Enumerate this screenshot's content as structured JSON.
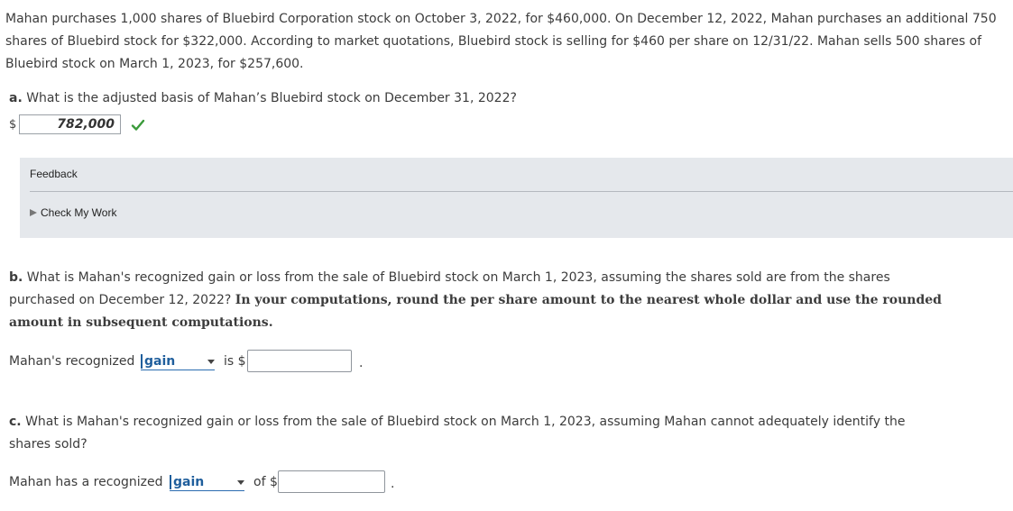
{
  "intro": "Mahan purchases 1,000 shares of Bluebird Corporation stock on October 3, 2022, for $460,000. On December 12, 2022, Mahan purchases an additional 750 shares of Bluebird stock for $322,000. According to market quotations, Bluebird stock is selling for $460 per share on 12/31/22. Mahan sells 500 shares of Bluebird stock on March 1, 2023, for $257,600.",
  "part_a": {
    "label": "a.",
    "question": "What is the adjusted basis of Mahan’s Bluebird stock on December 31, 2022?",
    "currency": "$",
    "answer": "782,000"
  },
  "feedback": {
    "title": "Feedback",
    "check_my_work": "Check My Work"
  },
  "part_b": {
    "label": "b.",
    "question": "What is Mahan's recognized gain or loss from the sale of Bluebird stock on March 1, 2023, assuming the shares sold are from the shares purchased on December 12, 2022?",
    "instruction": "In your computations, round the per share amount to the nearest whole dollar and use the rounded amount in subsequent computations.",
    "prefix": "Mahan's recognized",
    "selected": "gain",
    "mid": "is $",
    "suffix": "."
  },
  "part_c": {
    "label": "c.",
    "question": "What is Mahan's recognized gain or loss from the sale of Bluebird stock on March 1, 2023, assuming Mahan cannot adequately identify the shares sold?",
    "prefix": "Mahan has a recognized",
    "selected": "gain",
    "mid": "of $",
    "suffix": "."
  },
  "colors": {
    "accent": "#1f5e9c",
    "check": "#3a9a3a",
    "panel": "#e5e8ec"
  },
  "icons": {
    "correct": "check-icon",
    "expand": "triangle-right-icon",
    "dropdown": "caret-down-icon"
  }
}
